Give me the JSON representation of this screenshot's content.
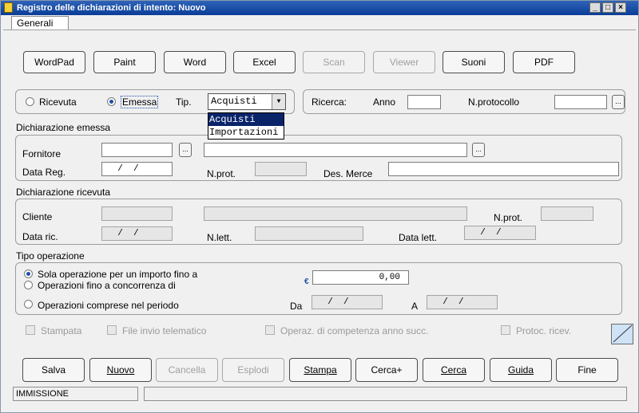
{
  "window": {
    "title": "Registro delle dichiarazioni di intento: Nuovo",
    "min": "_",
    "max": "□",
    "close": "×"
  },
  "tabs": [
    {
      "label": "Generali"
    }
  ],
  "toolbar": [
    {
      "label": "WordPad"
    },
    {
      "label": "Paint"
    },
    {
      "label": "Word"
    },
    {
      "label": "Excel"
    },
    {
      "label": "Scan"
    },
    {
      "label": "Viewer"
    },
    {
      "label": "Suoni"
    },
    {
      "label": "PDF"
    }
  ],
  "tipo": {
    "ricevuta": "Ricevuta",
    "emessa": "Emessa",
    "tip_label": "Tip.",
    "tip_value": "Acquisti",
    "options": [
      "Acquisti",
      "Importazioni"
    ]
  },
  "ricerca": {
    "label": "Ricerca:",
    "anno_label": "Anno",
    "anno_value": "",
    "nprot_label": "N.protocollo",
    "nprot_value": ""
  },
  "emessa": {
    "title": "Dichiarazione emessa",
    "fornitore_label": "Fornitore",
    "fornitore_code": "",
    "fornitore_name": "",
    "datareg_label": "Data Reg.",
    "datareg_value": "  /  /",
    "nprot_label": "N.prot.",
    "nprot_value": "",
    "desmerce_label": "Des. Merce",
    "desmerce_value": ""
  },
  "ricevuta": {
    "title": "Dichiarazione ricevuta",
    "cliente_label": "Cliente",
    "cliente_code": "",
    "cliente_name": "",
    "nprot_label": "N.prot.",
    "nprot_value": "",
    "dataric_label": "Data ric.",
    "dataric_value": "  /  /",
    "nlett_label": "N.lett.",
    "nlett_value": "",
    "datalett_label": "Data lett.",
    "datalett_value": "  /  /"
  },
  "operazione": {
    "title": "Tipo operazione",
    "opt1": "Sola operazione per un importo fino a",
    "opt2": "Operazioni fino a concorrenza di",
    "opt3": "Operazioni comprese nel periodo",
    "currency": "€",
    "importo": "0,00",
    "da_label": "Da",
    "da_value": "  /  /",
    "a_label": "A",
    "a_value": "  /  /"
  },
  "flags": {
    "stampata": "Stampata",
    "file_invio": "File invio telematico",
    "operaz": "Operaz. di competenza anno succ.",
    "protoc": "Protoc. ricev."
  },
  "actions": [
    {
      "label": "Salva"
    },
    {
      "label": "Nuovo"
    },
    {
      "label": "Cancella"
    },
    {
      "label": "Esplodi"
    },
    {
      "label": "Stampa"
    },
    {
      "label": "Cerca+"
    },
    {
      "label": "Cerca"
    },
    {
      "label": "Guida"
    },
    {
      "label": "Fine"
    }
  ],
  "status": {
    "mode": "IMMISSIONE",
    "message": ""
  },
  "colors": {
    "titlebar": "#0a3d97",
    "selection": "#0a246a"
  }
}
